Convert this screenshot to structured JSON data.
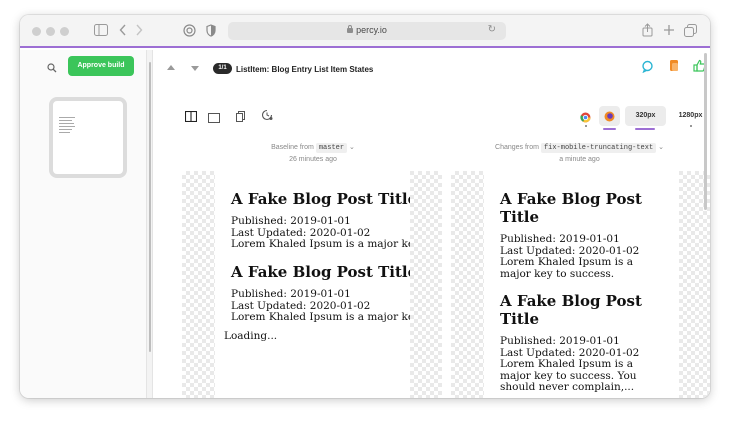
{
  "browser": {
    "url": "percy.io"
  },
  "sidebar": {
    "approve_label": "Approve build"
  },
  "snapshot": {
    "badge": "1/1",
    "title": "ListItem: Blog Entry List Item States"
  },
  "widths": {
    "narrow": "320px",
    "wide": "1280px"
  },
  "baseline": {
    "prefix": "Baseline from",
    "branch": "master",
    "time": "26 minutes ago"
  },
  "changes": {
    "prefix": "Changes from",
    "branch": "fix-mobile-truncating-text",
    "time": "a minute ago"
  },
  "left_page": {
    "posts": [
      {
        "title": "A Fake Blog Post Title",
        "published": "Published: 2019-01-01",
        "updated": "Last Updated: 2020-01-02",
        "excerpt": "Lorem Khaled Ipsum is a major key"
      },
      {
        "title": "A Fake Blog Post Title",
        "published": "Published: 2019-01-01",
        "updated": "Last Updated: 2020-01-02",
        "excerpt": "Lorem Khaled Ipsum is a major key"
      }
    ],
    "loading": "Loading..."
  },
  "right_page": {
    "posts": [
      {
        "title": "A Fake Blog Post Title",
        "published": "Published: 2019-01-01",
        "updated": "Last Updated: 2020-01-02",
        "excerpt": "Lorem Khaled Ipsum is a major key to success."
      },
      {
        "title": "A Fake Blog Post Title",
        "published": "Published: 2019-01-01",
        "updated": "Last Updated: 2020-01-02",
        "excerpt": "Lorem Khaled Ipsum is a major key to success. You should never complain,..."
      }
    ]
  },
  "colors": {
    "accent": "#9d6fd4",
    "approve": "#3bc55a",
    "comment": "#2bb5d3",
    "approve_icon": "#3bc55a",
    "firefox": "#f08a24"
  }
}
